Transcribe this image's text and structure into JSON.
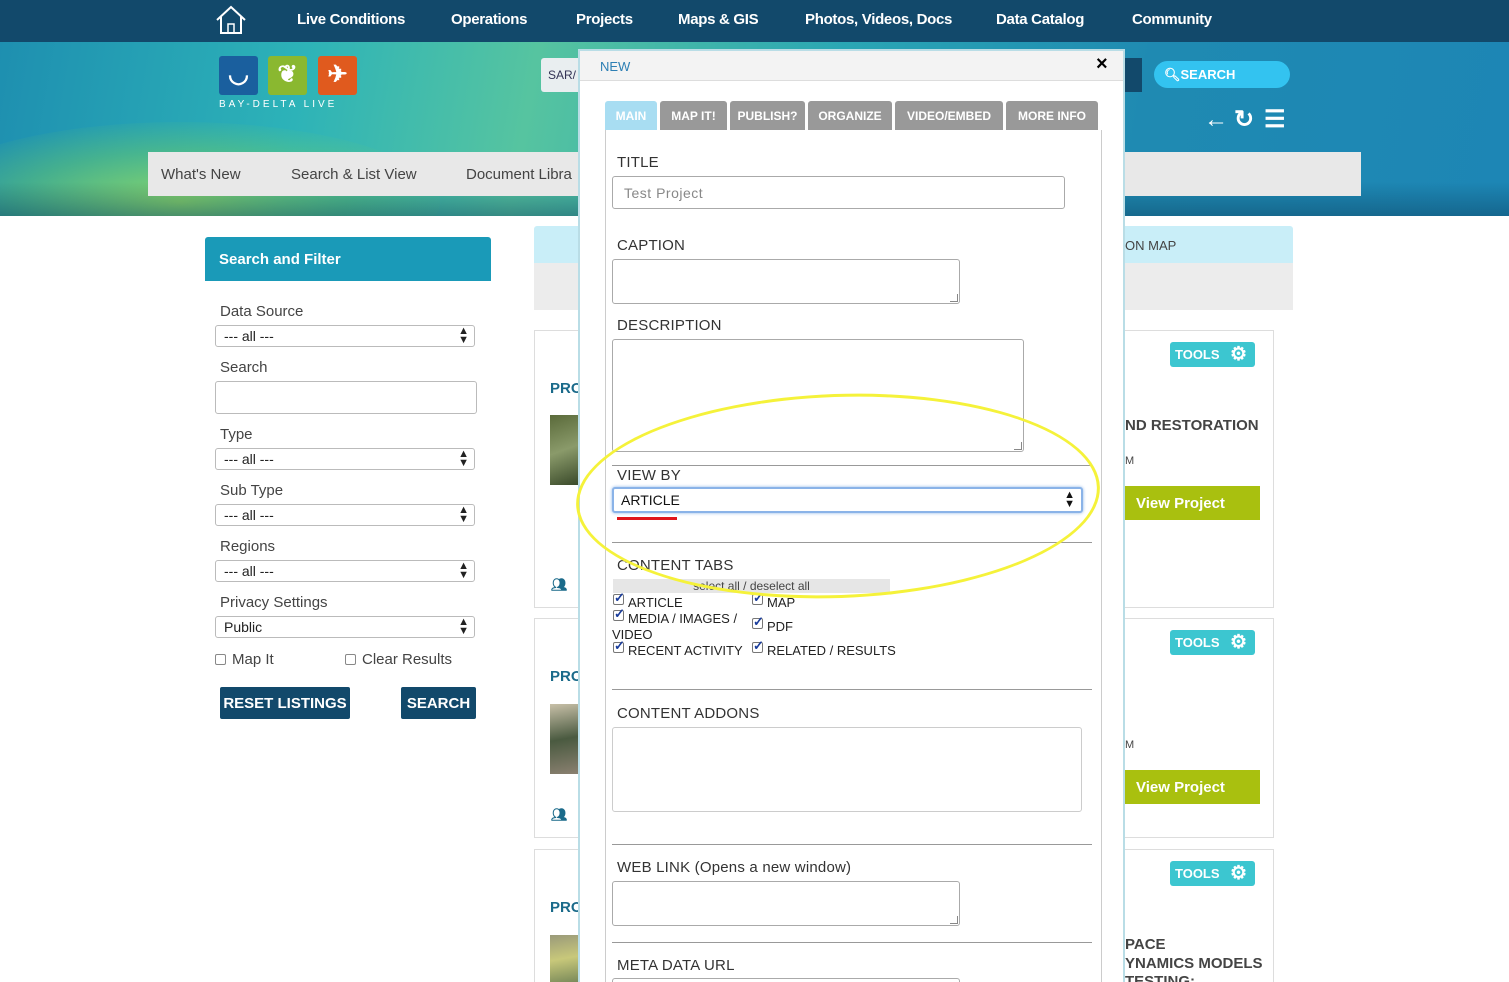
{
  "topnav": {
    "home_icon": "home-icon",
    "links": [
      "Live Conditions",
      "Operations",
      "Projects",
      "Maps & GIS",
      "Photos, Videos, Docs",
      "Data Catalog",
      "Community"
    ]
  },
  "logo": {
    "caption": "BAY-DELTA LIVE",
    "tiles": [
      "whale-icon",
      "leaf-icon",
      "bird-icon"
    ]
  },
  "header": {
    "search_partial": "SAR/",
    "search_button": "SEARCH",
    "icons": [
      "back-arrow-icon",
      "refresh-icon",
      "list-icon"
    ]
  },
  "subnav": {
    "items": [
      "What's New",
      "Search & List View",
      "Document Libra"
    ]
  },
  "sidebar": {
    "title": "Search and Filter",
    "data_source_label": "Data Source",
    "data_source_value": "--- all ---",
    "search_label": "Search",
    "type_label": "Type",
    "type_value": "--- all ---",
    "subtype_label": "Sub Type",
    "subtype_value": "--- all ---",
    "regions_label": "Regions",
    "regions_value": "--- all ---",
    "privacy_label": "Privacy Settings",
    "privacy_value": "Public",
    "map_it_label": "Map It",
    "clear_results_label": "Clear Results",
    "reset_button": "RESET LISTINGS",
    "search_button": "SEARCH"
  },
  "content": {
    "on_map_label": "ON MAP",
    "cards": [
      {
        "pro": "PRO",
        "tools": "TOOLS",
        "title": "ND RESTORATION",
        "small": "M",
        "button": "View Project"
      },
      {
        "pro": "PRO",
        "tools": "TOOLS",
        "title": "",
        "small": "M",
        "button": "View Project"
      },
      {
        "pro": "PRO",
        "tools": "TOOLS",
        "title": "PACE",
        "title2": "YNAMICS MODELS",
        "title3": "TESTING:"
      }
    ]
  },
  "modal": {
    "title": "NEW",
    "close": "×",
    "tabs": [
      "MAIN",
      "MAP IT!",
      "PUBLISH?",
      "ORGANIZE",
      "VIDEO/EMBED",
      "MORE INFO"
    ],
    "active_tab": "MAIN",
    "title_label": "TITLE",
    "title_placeholder": "Test Project",
    "caption_label": "CAPTION",
    "description_label": "DESCRIPTION",
    "view_by_label": "VIEW BY",
    "view_by_value": "ARTICLE",
    "content_tabs_label": "CONTENT TABS",
    "select_all": "select all / deselect all",
    "content_tabs": [
      "ARTICLE",
      "MAP",
      "MEDIA / IMAGES /",
      "VIDEO",
      "PDF",
      "RECENT ACTIVITY",
      "RELATED / RESULTS"
    ],
    "content_addons_label": "CONTENT ADDONS",
    "web_link_label": "WEB LINK (Opens a new window)",
    "meta_data_label": "META DATA URL"
  },
  "colors": {
    "nav": "#12496b",
    "accent": "#1a9ab8",
    "highlight": "#f5f23a",
    "view_project": "#a9c00f",
    "tools": "#3cc6d0"
  }
}
